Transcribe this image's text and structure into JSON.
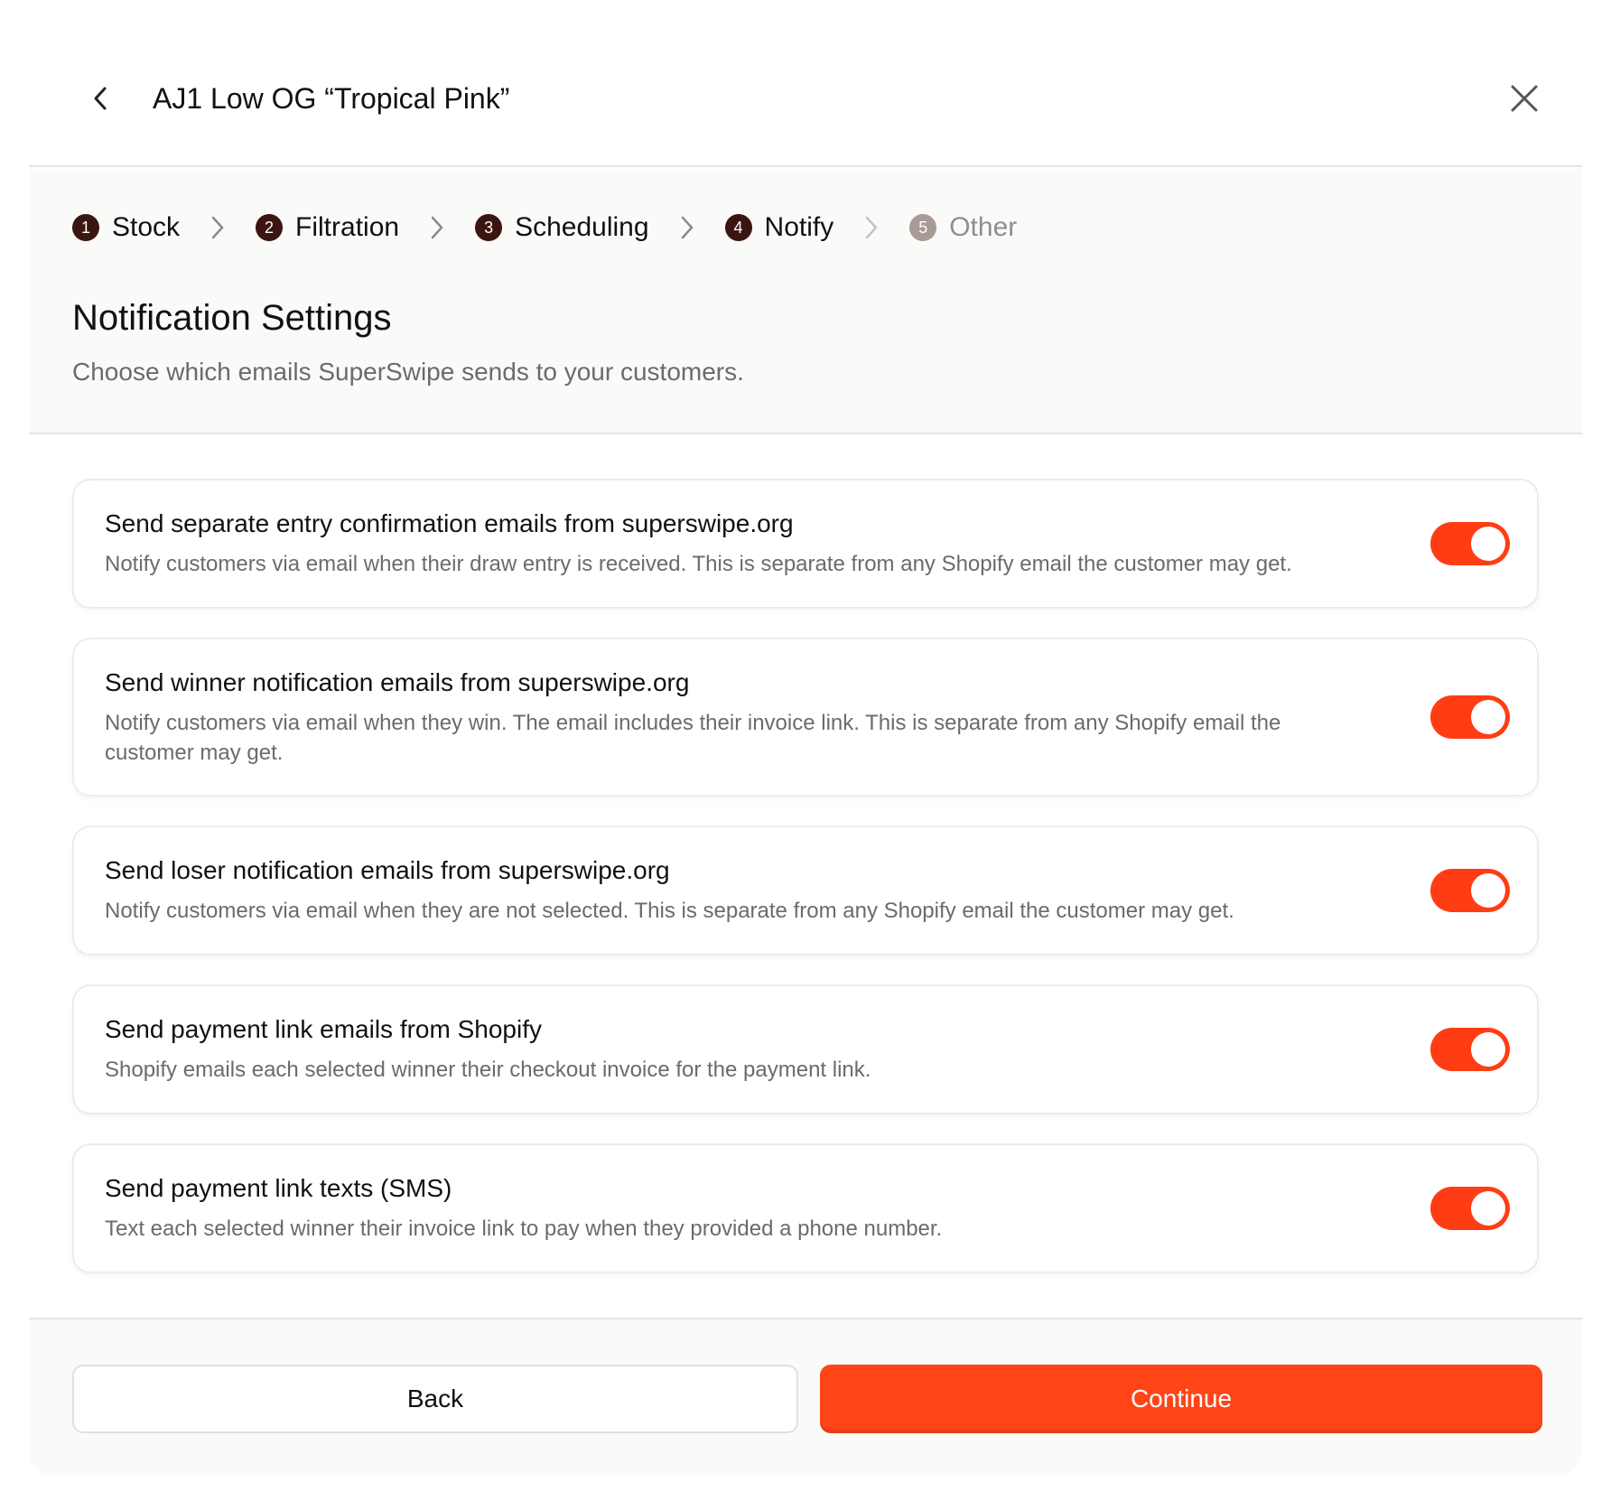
{
  "header": {
    "title": "AJ1 Low OG “Tropical Pink”",
    "back_icon": "chevron-left-icon",
    "close_icon": "close-icon"
  },
  "steps": [
    {
      "num": "1",
      "label": "Stock",
      "active": true
    },
    {
      "num": "2",
      "label": "Filtration",
      "active": true
    },
    {
      "num": "3",
      "label": "Scheduling",
      "active": true
    },
    {
      "num": "4",
      "label": "Notify",
      "active": true
    },
    {
      "num": "5",
      "label": "Other",
      "active": false
    }
  ],
  "section": {
    "title": "Notification Settings",
    "subtitle": "Choose which emails SuperSwipe sends to your customers."
  },
  "settings": [
    {
      "title": "Send separate entry confirmation emails from superswipe.org",
      "description": "Notify customers via email when their draw entry is received. This is separate from any Shopify email the customer may get.",
      "enabled": true
    },
    {
      "title": "Send winner notification emails from superswipe.org",
      "description": "Notify customers via email when they win. The email includes their invoice link. This is separate from any Shopify email the customer may get.",
      "enabled": true
    },
    {
      "title": "Send loser notification emails from superswipe.org",
      "description": "Notify customers via email when they are not selected. This is separate from any Shopify email the customer may get.",
      "enabled": true
    },
    {
      "title": "Send payment link emails from Shopify",
      "description": "Shopify emails each selected winner their checkout invoice for the payment link.",
      "enabled": true
    },
    {
      "title": "Send payment link texts (SMS)",
      "description": "Text each selected winner their invoice link to pay when they provided a phone number.",
      "enabled": true
    }
  ],
  "footer": {
    "back_label": "Back",
    "continue_label": "Continue"
  },
  "colors": {
    "accent": "#ff4518",
    "toggle_on": "#ff3d14",
    "step_active": "#3b1510",
    "step_inactive": "#a89a97"
  }
}
